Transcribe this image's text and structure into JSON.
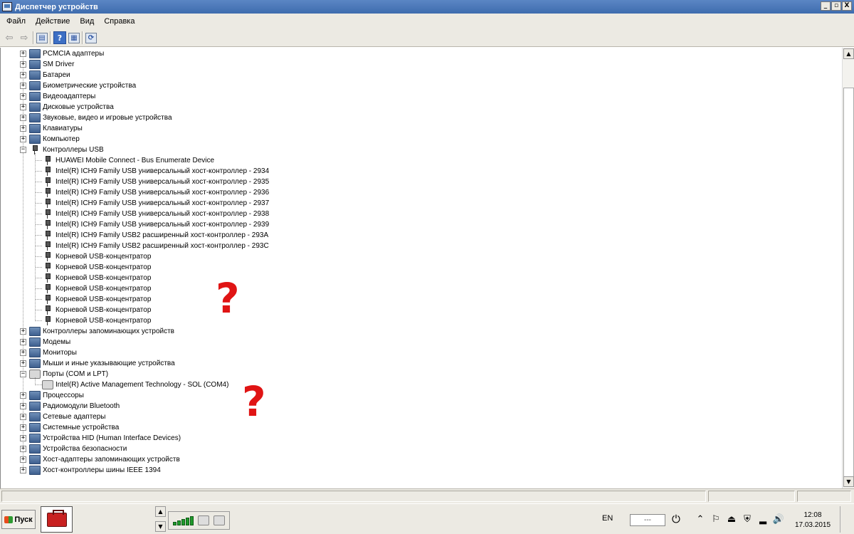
{
  "window": {
    "title": "Диспетчер устройств",
    "controls": [
      "_",
      "▫",
      "X"
    ]
  },
  "menu": [
    "Файл",
    "Действие",
    "Вид",
    "Справка"
  ],
  "toolbar": {
    "buttons": [
      "back-icon",
      "forward-icon",
      "properties-icon",
      "help-icon",
      "view-icon",
      "scan-hardware-icon"
    ]
  },
  "tree": {
    "items": [
      {
        "label": "PCMCIA адаптеры",
        "level": 0,
        "expanded": false,
        "icon": "pcmcia-icon"
      },
      {
        "label": "SM Driver",
        "level": 0,
        "expanded": false,
        "icon": "sm-driver-icon"
      },
      {
        "label": "Батареи",
        "level": 0,
        "expanded": false,
        "icon": "battery-icon"
      },
      {
        "label": "Биометрические устройства",
        "level": 0,
        "expanded": false,
        "icon": "biometric-icon"
      },
      {
        "label": "Видеоадаптеры",
        "level": 0,
        "expanded": false,
        "icon": "display-adapter-icon"
      },
      {
        "label": "Дисковые устройства",
        "level": 0,
        "expanded": false,
        "icon": "disk-icon"
      },
      {
        "label": "Звуковые, видео и игровые устройства",
        "level": 0,
        "expanded": false,
        "icon": "sound-icon"
      },
      {
        "label": "Клавиатуры",
        "level": 0,
        "expanded": false,
        "icon": "keyboard-icon"
      },
      {
        "label": "Компьютер",
        "level": 0,
        "expanded": false,
        "icon": "computer-icon"
      },
      {
        "label": "Контроллеры USB",
        "level": 0,
        "expanded": true,
        "icon": "usb-icon"
      },
      {
        "label": "HUAWEI Mobile Connect - Bus Enumerate Device",
        "level": 1,
        "icon": "usb-icon"
      },
      {
        "label": "Intel(R) ICH9 Family USB универсальный хост-контроллер  - 2934",
        "level": 1,
        "icon": "usb-icon"
      },
      {
        "label": "Intel(R) ICH9 Family USB универсальный хост-контроллер  - 2935",
        "level": 1,
        "icon": "usb-icon"
      },
      {
        "label": "Intel(R) ICH9 Family USB универсальный хост-контроллер  - 2936",
        "level": 1,
        "icon": "usb-icon"
      },
      {
        "label": "Intel(R) ICH9 Family USB универсальный хост-контроллер  - 2937",
        "level": 1,
        "icon": "usb-icon"
      },
      {
        "label": "Intel(R) ICH9 Family USB универсальный хост-контроллер  - 2938",
        "level": 1,
        "icon": "usb-icon"
      },
      {
        "label": "Intel(R) ICH9 Family USB универсальный хост-контроллер  - 2939",
        "level": 1,
        "icon": "usb-icon"
      },
      {
        "label": "Intel(R) ICH9 Family USB2 расширенный хост-контроллер  - 293A",
        "level": 1,
        "icon": "usb-icon"
      },
      {
        "label": "Intel(R) ICH9 Family USB2 расширенный хост-контроллер  - 293C",
        "level": 1,
        "icon": "usb-icon"
      },
      {
        "label": "Корневой USB-концентратор",
        "level": 1,
        "icon": "usb-icon"
      },
      {
        "label": "Корневой USB-концентратор",
        "level": 1,
        "icon": "usb-icon"
      },
      {
        "label": "Корневой USB-концентратор",
        "level": 1,
        "icon": "usb-icon"
      },
      {
        "label": "Корневой USB-концентратор",
        "level": 1,
        "icon": "usb-icon"
      },
      {
        "label": "Корневой USB-концентратор",
        "level": 1,
        "icon": "usb-icon"
      },
      {
        "label": "Корневой USB-концентратор",
        "level": 1,
        "icon": "usb-icon"
      },
      {
        "label": "Корневой USB-концентратор",
        "level": 1,
        "icon": "usb-icon"
      },
      {
        "label": "Контроллеры запоминающих устройств",
        "level": 0,
        "expanded": false,
        "icon": "storage-controller-icon"
      },
      {
        "label": "Модемы",
        "level": 0,
        "expanded": false,
        "icon": "modem-icon"
      },
      {
        "label": "Мониторы",
        "level": 0,
        "expanded": false,
        "icon": "monitor-icon"
      },
      {
        "label": "Мыши и иные указывающие устройства",
        "level": 0,
        "expanded": false,
        "icon": "mouse-icon"
      },
      {
        "label": "Порты (COM и LPT)",
        "level": 0,
        "expanded": true,
        "icon": "port-icon"
      },
      {
        "label": "Intel(R) Active Management Technology - SOL (COM4)",
        "level": 1,
        "icon": "port-icon"
      },
      {
        "label": "Процессоры",
        "level": 0,
        "expanded": false,
        "icon": "processor-icon"
      },
      {
        "label": "Радиомодули Bluetooth",
        "level": 0,
        "expanded": false,
        "icon": "bluetooth-icon"
      },
      {
        "label": "Сетевые адаптеры",
        "level": 0,
        "expanded": false,
        "icon": "network-adapter-icon"
      },
      {
        "label": "Системные устройства",
        "level": 0,
        "expanded": false,
        "icon": "system-devices-icon"
      },
      {
        "label": "Устройства HID (Human Interface Devices)",
        "level": 0,
        "expanded": false,
        "icon": "hid-icon"
      },
      {
        "label": "Устройства безопасности",
        "level": 0,
        "expanded": false,
        "icon": "security-device-icon"
      },
      {
        "label": "Хост-адаптеры запоминающих устройств",
        "level": 0,
        "expanded": false,
        "icon": "storage-host-icon"
      },
      {
        "label": "Хост-контроллеры шины IEEE 1394",
        "level": 0,
        "expanded": false,
        "icon": "ieee1394-icon"
      }
    ]
  },
  "annotations": {
    "mark1": "?",
    "mark2": "?",
    "color": "#e01414"
  },
  "taskbar": {
    "start_label": "Пуск",
    "language": "EN",
    "network_text": "---",
    "time": "12:08",
    "date": "17.03.2015"
  }
}
